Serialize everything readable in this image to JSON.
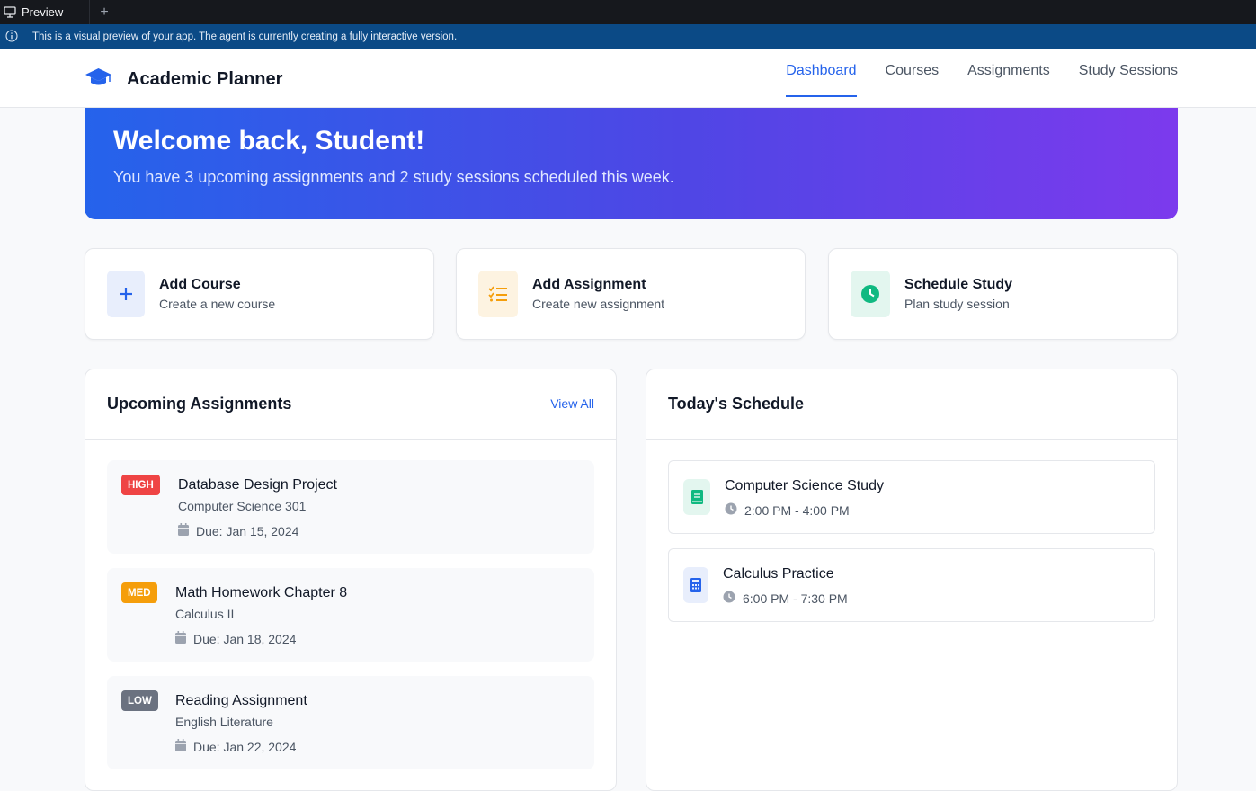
{
  "browser": {
    "tab_label": "Preview",
    "new_tab_symbol": "+",
    "banner_text": "This is a visual preview of your app. The agent is currently creating a fully interactive version."
  },
  "header": {
    "app_title": "Academic Planner",
    "logo_icon": "graduation-cap-icon",
    "nav": [
      {
        "label": "Dashboard",
        "active": true
      },
      {
        "label": "Courses",
        "active": false
      },
      {
        "label": "Assignments",
        "active": false
      },
      {
        "label": "Study Sessions",
        "active": false
      }
    ]
  },
  "hero": {
    "title": "Welcome back, Student!",
    "subtitle": "You have 3 upcoming assignments and 2 study sessions scheduled this week."
  },
  "quick_actions": [
    {
      "title": "Add Course",
      "subtitle": "Create a new course",
      "icon": "plus-icon",
      "icon_color": "#2563eb",
      "icon_bg": "#e8eefc"
    },
    {
      "title": "Add Assignment",
      "subtitle": "Create new assignment",
      "icon": "checklist-icon",
      "icon_color": "#f59e0b",
      "icon_bg": "#fdf3e1"
    },
    {
      "title": "Schedule Study",
      "subtitle": "Plan study session",
      "icon": "clock-icon",
      "icon_color": "#10b981",
      "icon_bg": "#e3f6ef"
    }
  ],
  "upcoming": {
    "title": "Upcoming Assignments",
    "view_all": "View All",
    "items": [
      {
        "priority": "HIGH",
        "priority_color": "#ef4444",
        "title": "Database Design Project",
        "course": "Computer Science 301",
        "due": "Due: Jan 15, 2024"
      },
      {
        "priority": "MED",
        "priority_color": "#f59e0b",
        "title": "Math Homework Chapter 8",
        "course": "Calculus II",
        "due": "Due: Jan 18, 2024"
      },
      {
        "priority": "LOW",
        "priority_color": "#6b7280",
        "title": "Reading Assignment",
        "course": "English Literature",
        "due": "Due: Jan 22, 2024"
      }
    ]
  },
  "schedule": {
    "title": "Today's Schedule",
    "items": [
      {
        "title": "Computer Science Study",
        "time": "2:00 PM - 4:00 PM",
        "icon": "book-icon",
        "icon_color": "#10b981",
        "icon_bg": "#e3f6ef"
      },
      {
        "title": "Calculus Practice",
        "time": "6:00 PM - 7:30 PM",
        "icon": "calculator-icon",
        "icon_color": "#2563eb",
        "icon_bg": "#e8eefc"
      }
    ]
  }
}
